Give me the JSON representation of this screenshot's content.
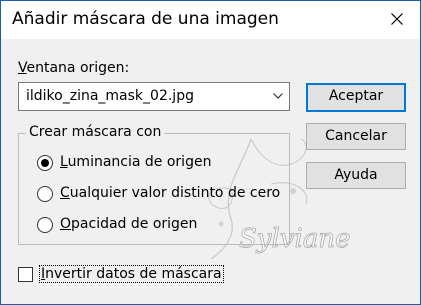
{
  "dialog": {
    "title": "Añadir máscara de una imagen"
  },
  "source": {
    "label_accel": "V",
    "label_rest": "entana origen:",
    "value": "ildiko_zina_mask_02.jpg"
  },
  "buttons": {
    "accept": "Aceptar",
    "cancel": "Cancelar",
    "help": "Ayuda"
  },
  "mask_group": {
    "legend": "Crear máscara con",
    "options": [
      {
        "accel": "L",
        "rest": "uminancia de origen",
        "selected": true
      },
      {
        "accel": "C",
        "rest": "ualquier valor distinto de cero",
        "selected": false
      },
      {
        "accel": "O",
        "rest": "pacidad de origen",
        "selected": false
      }
    ]
  },
  "invert": {
    "accel": "I",
    "rest": "nvertir datos de máscara",
    "checked": false
  },
  "watermark": {
    "text": "Sylviane"
  },
  "colors": {
    "accent": "#0078d7",
    "window_border": "#1c5ea8",
    "dialog_bg": "#f0f0f0"
  },
  "icons": [
    "close-icon",
    "chevron-down-icon"
  ]
}
